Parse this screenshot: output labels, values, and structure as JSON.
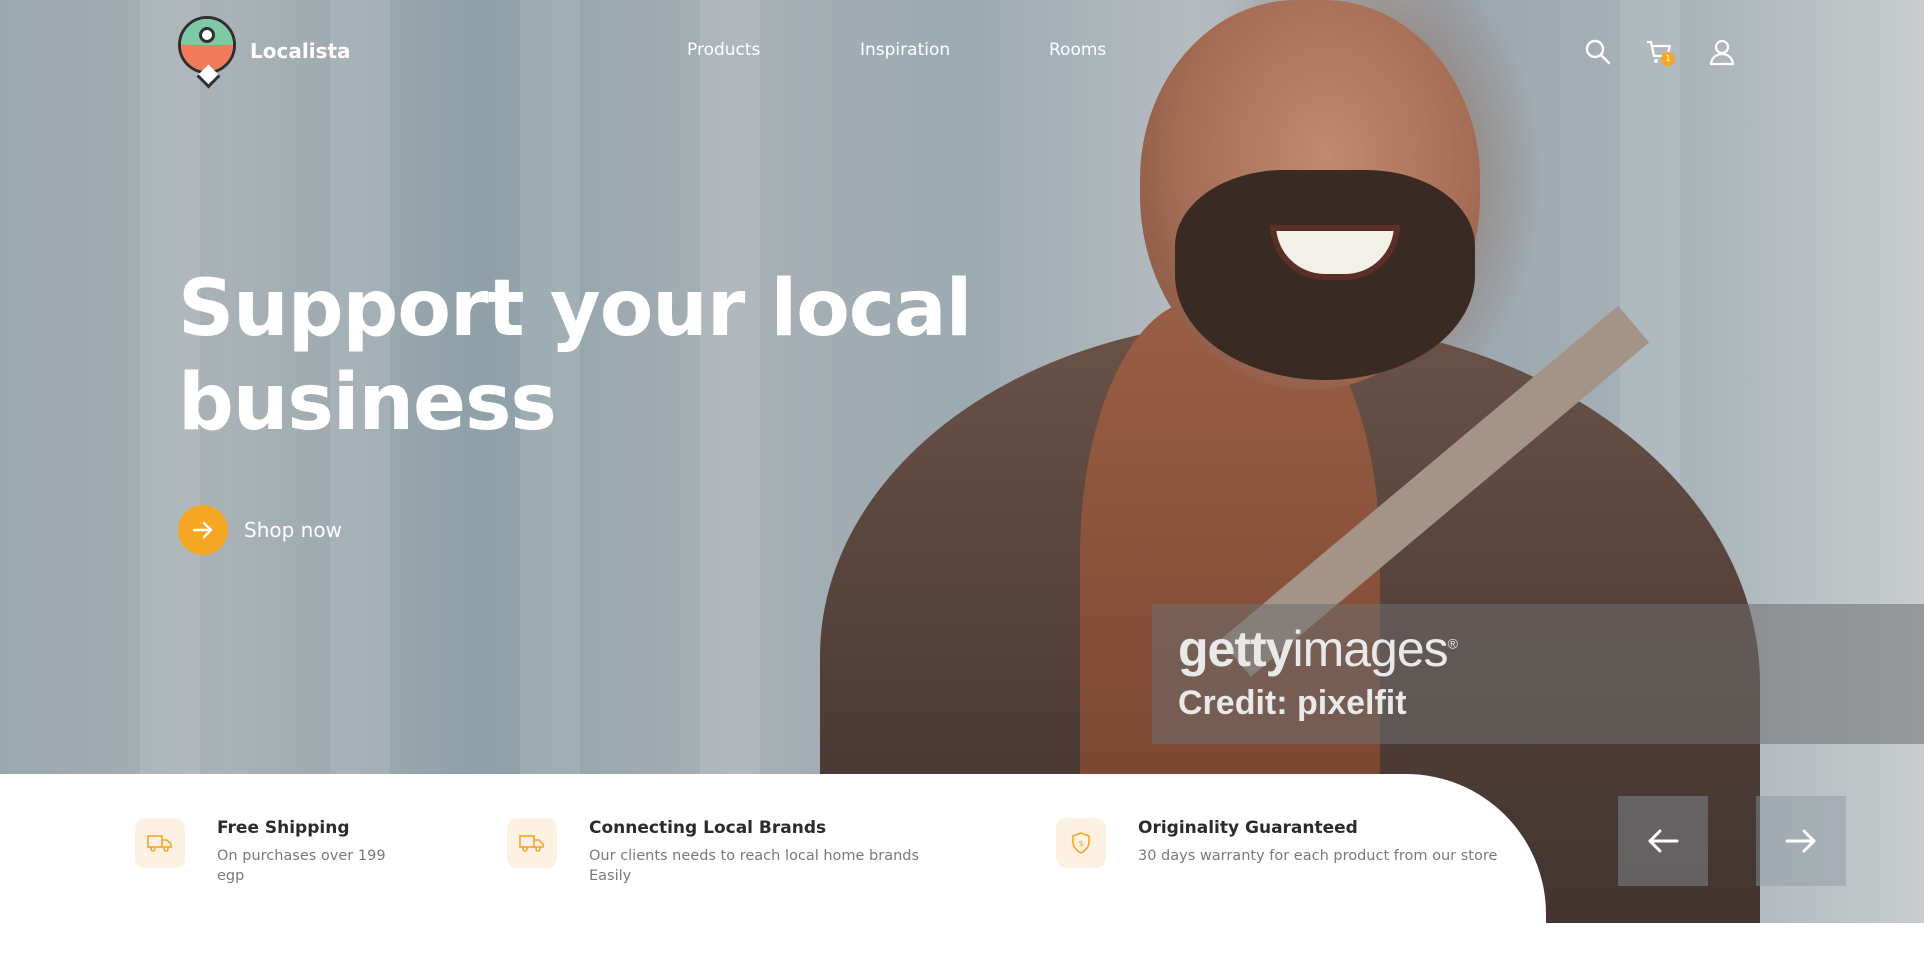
{
  "brand": {
    "name": "Localista"
  },
  "nav": {
    "items": [
      {
        "label": "Products"
      },
      {
        "label": "Inspiration"
      },
      {
        "label": "Rooms"
      }
    ]
  },
  "header_icons": {
    "search": "search-icon",
    "cart": "cart-icon",
    "account": "user-icon",
    "cart_count": "1"
  },
  "hero": {
    "headline": "Support your local business",
    "cta_label": "Shop now",
    "background": "photo of smiling man in brown coat"
  },
  "watermark": {
    "logo_bold": "getty",
    "logo_light": "images",
    "mark": "®",
    "credit": "Credit: pixelfit"
  },
  "features": [
    {
      "icon": "truck-icon",
      "title": "Free Shipping",
      "description": "On purchases over 199 egp"
    },
    {
      "icon": "truck-icon",
      "title": "Connecting Local Brands",
      "description": "Our clients needs to reach local home brands Easily"
    },
    {
      "icon": "shield-icon",
      "title": "Originality Guaranteed",
      "description": "30 days warranty for each product from our store"
    }
  ],
  "carousel": {
    "prev": "arrow-left-icon",
    "next": "arrow-right-icon"
  },
  "colors": {
    "accent": "#f5a623",
    "feature_icon_bg": "#fdf1e4",
    "text_dark": "#2b2b2b",
    "text_muted": "#7a7a7a"
  }
}
